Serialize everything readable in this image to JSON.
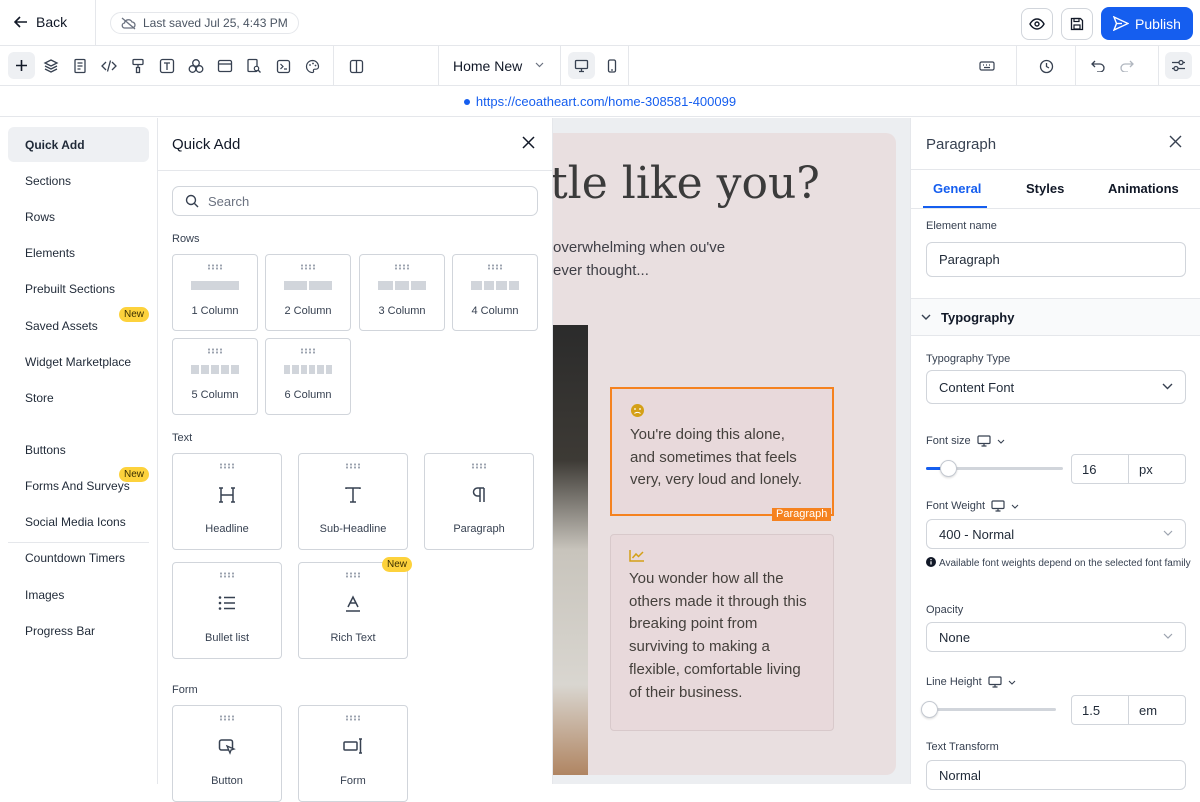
{
  "topbar": {
    "back_label": "Back",
    "last_saved": "Last saved Jul 25, 4:43 PM",
    "publish_label": "Publish"
  },
  "toolbar": {
    "page_name": "Home New"
  },
  "url": "https://ceoatheart.com/home-308581-400099",
  "canvas": {
    "hero_title": "tle like you?",
    "hero_sub": "overwhelming when ou've ever thought...",
    "card1_text": "You're doing this alone, and sometimes that feels very, very loud and lonely.",
    "card2_text": "You wonder how all the others made it through this breaking point from surviving to making a flexible, comfortable living of their business.",
    "selected_tag": "Paragraph"
  },
  "leftnav": {
    "items": [
      "Quick Add",
      "Sections",
      "Rows",
      "Elements",
      "Prebuilt Sections",
      "Saved Assets",
      "Widget Marketplace",
      "Store"
    ],
    "items2": [
      "Buttons",
      "Forms And Surveys",
      "Social Media Icons",
      "Countdown Timers",
      "Images",
      "Progress Bar"
    ],
    "new_badge": "New"
  },
  "quickadd": {
    "title": "Quick Add",
    "search_placeholder": "Search",
    "rows_label": "Rows",
    "rows": [
      "1 Column",
      "2 Column",
      "3 Column",
      "4 Column",
      "5 Column",
      "6 Column"
    ],
    "text_label": "Text",
    "text_items": [
      "Headline",
      "Sub-Headline",
      "Paragraph",
      "Bullet list",
      "Rich Text"
    ],
    "form_label": "Form",
    "form_items": [
      "Button",
      "Form"
    ]
  },
  "rightpanel": {
    "title": "Paragraph",
    "tabs": [
      "General",
      "Styles",
      "Animations"
    ],
    "element_name_label": "Element name",
    "element_name_value": "Paragraph",
    "typography_label": "Typography",
    "typography_type_label": "Typography Type",
    "typography_type_value": "Content Font",
    "font_size_label": "Font size",
    "font_size_value": "16",
    "font_size_unit": "px",
    "font_size_slider": 0.16,
    "font_weight_label": "Font Weight",
    "font_weight_value": "400 - Normal",
    "font_weight_note": "Available font weights depend on the selected font family",
    "opacity_label": "Opacity",
    "opacity_value": "None",
    "line_height_label": "Line Height",
    "line_height_value": "1.5",
    "line_height_unit": "em",
    "line_height_slider": 0.02,
    "text_transform_label": "Text Transform",
    "text_transform_value": "Normal"
  },
  "colors": {
    "accent": "#155eef",
    "selection": "#f5821f",
    "badge": "#fdd23c"
  }
}
